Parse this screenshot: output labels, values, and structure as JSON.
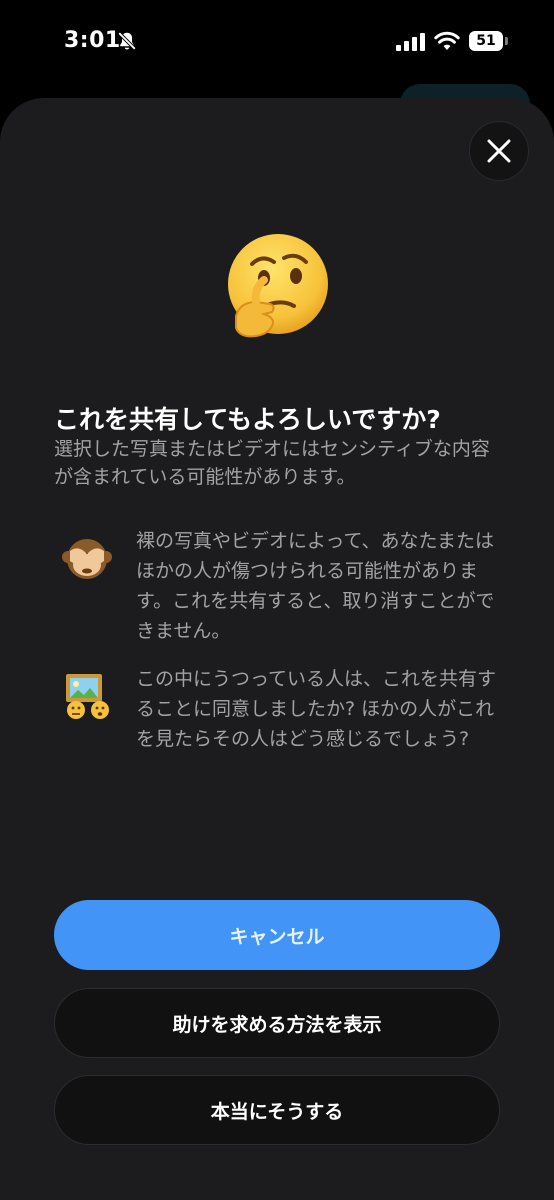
{
  "status_bar": {
    "time": "3:01",
    "battery": "51"
  },
  "dialog": {
    "title": "これを共有してもよろしいですか?",
    "subtitle": "選択した写真またはビデオにはセンシティブな内容が含まれている可能性があります。",
    "items": [
      {
        "icon": "see-no-evil-monkey-icon",
        "text": "裸の写真やビデオによって、あなたまたはほかの人が傷つけられる可能性があります。これを共有すると、取り消すことができません。"
      },
      {
        "icon": "framed-picture-faces-icon",
        "text": "この中にうつっている人は、これを共有することに同意しましたか? ほかの人がこれを見たらその人はどう感じるでしょう?"
      }
    ],
    "buttons": {
      "cancel": "キャンセル",
      "help": "助けを求める方法を表示",
      "confirm": "本当にそうする"
    }
  },
  "colors": {
    "sheet_bg": "#1c1c1e",
    "primary_button": "#4294f7",
    "secondary_text": "#a1a1a6"
  }
}
